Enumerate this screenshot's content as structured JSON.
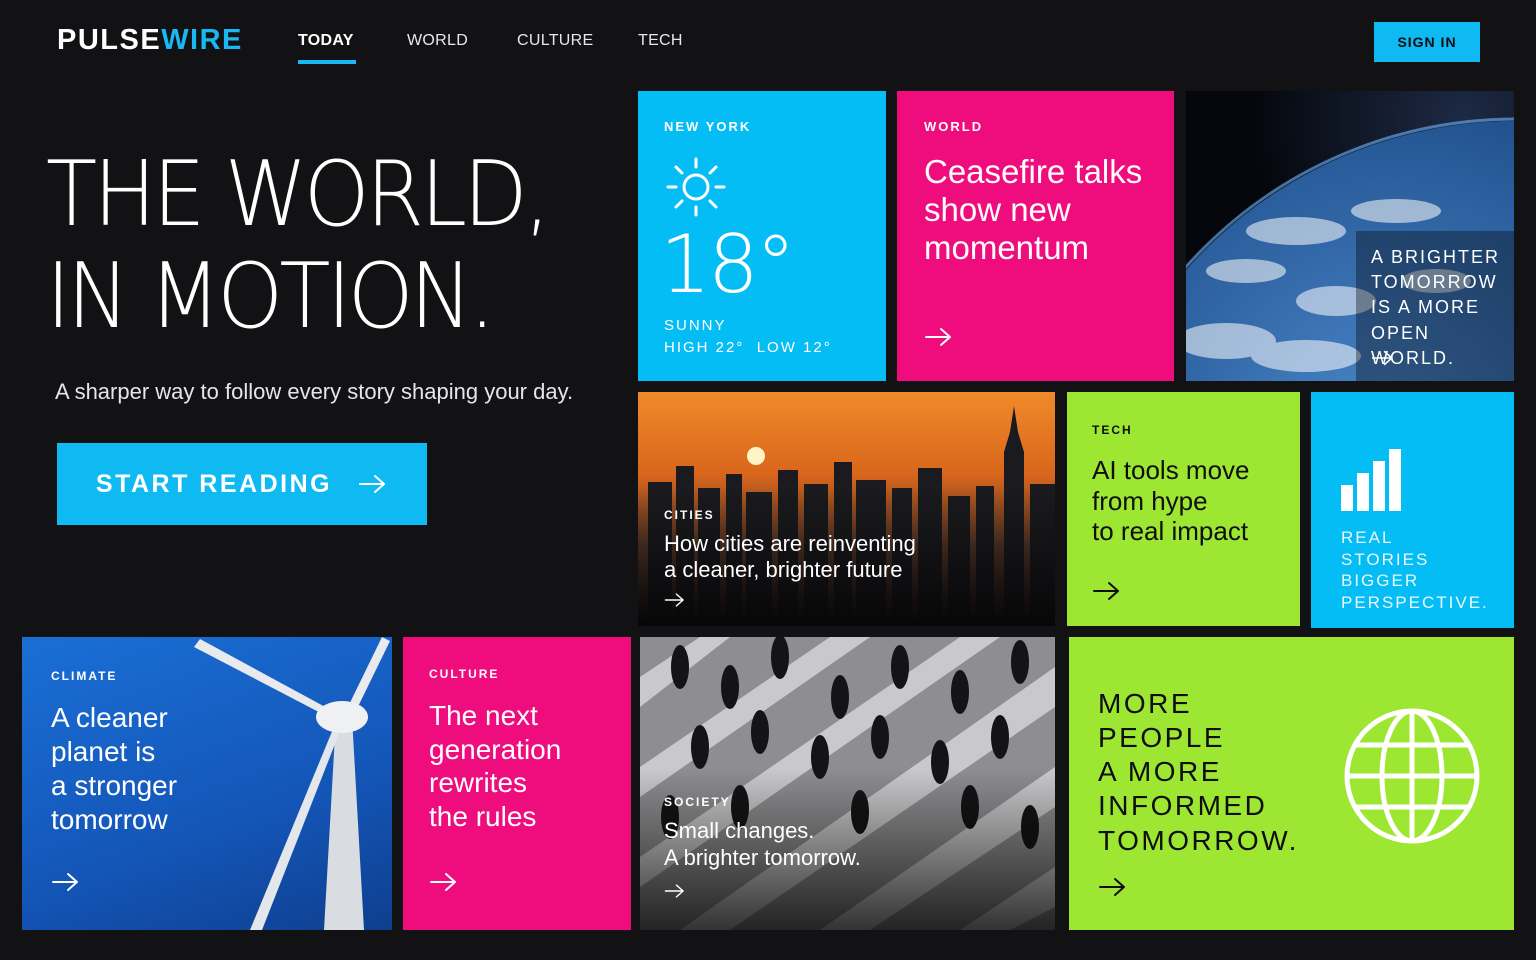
{
  "brand": {
    "part1": "PULSE",
    "part2": "WIRE"
  },
  "nav": {
    "items": [
      {
        "label": "TODAY",
        "active": true
      },
      {
        "label": "WORLD",
        "active": false
      },
      {
        "label": "CULTURE",
        "active": false
      },
      {
        "label": "TECH",
        "active": false
      }
    ],
    "signin_label": "SIGN IN"
  },
  "hero": {
    "line1": "THE WORLD,",
    "line2": "IN MOTION.",
    "subtitle": "A sharper way to follow every story shaping your day.",
    "cta_label": "START READING"
  },
  "weather": {
    "location": "NEW YORK",
    "temp": "18°",
    "condition": "SUNNY",
    "high": "HIGH 22°",
    "low": "LOW 12°",
    "icon": "sun-icon"
  },
  "tiles": {
    "world": {
      "tag": "WORLD",
      "headline": [
        "Ceasefire talks",
        "show new",
        "momentum"
      ]
    },
    "earth": {
      "caption": [
        "A BRIGHTER",
        "TOMORROW",
        "IS A MORE",
        "OPEN WORLD."
      ]
    },
    "cities": {
      "tag": "CITIES",
      "headline": [
        "How cities are reinventing",
        "a cleaner, brighter future"
      ]
    },
    "tech": {
      "tag": "TECH",
      "headline": [
        "AI tools move",
        "from hype",
        "to real impact"
      ]
    },
    "stats": {
      "caption": [
        "REAL",
        "STORIES",
        "BIGGER",
        "PERSPECTIVE."
      ],
      "icon": "bar-chart-icon"
    },
    "climate": {
      "tag": "CLIMATE",
      "headline": [
        "A cleaner",
        "planet is",
        "a stronger",
        "tomorrow"
      ]
    },
    "culture": {
      "tag": "CULTURE",
      "headline": [
        "The next",
        "generation",
        "rewrites",
        "the rules"
      ]
    },
    "society": {
      "tag": "SOCIETY",
      "headline": [
        "Small changes.",
        "A brighter tomorrow."
      ]
    },
    "promo": {
      "caption": [
        "MORE",
        "PEOPLE",
        "A MORE",
        "INFORMED",
        "TOMORROW."
      ],
      "icon": "globe-icon"
    }
  },
  "colors": {
    "cyan": "#05bdf5",
    "pink": "#ef0c7c",
    "lime": "#9de632",
    "background": "#121214"
  }
}
